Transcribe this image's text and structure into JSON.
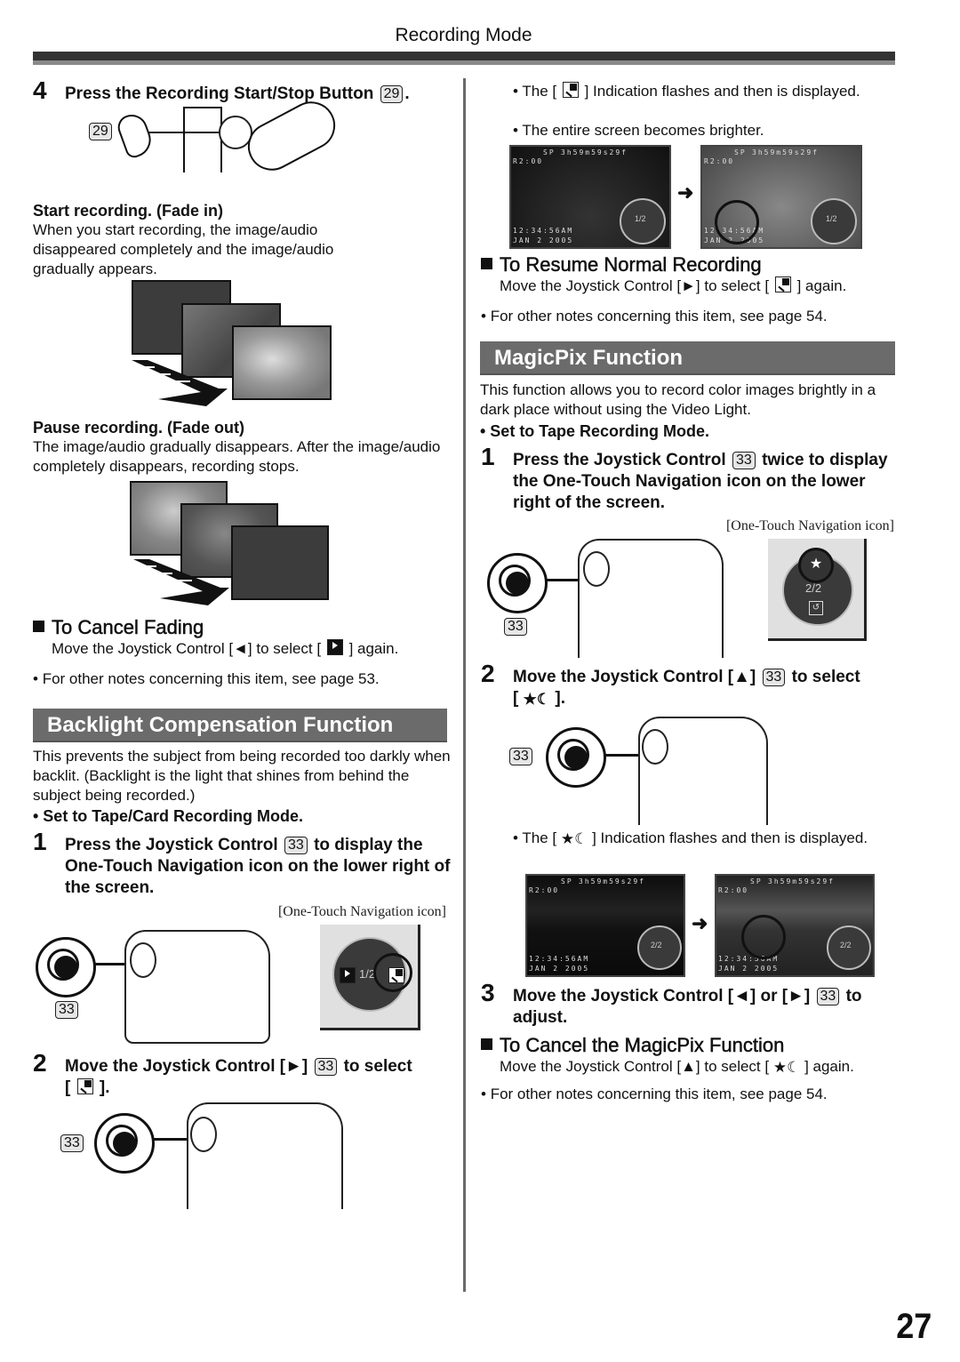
{
  "header": {
    "section_title": "Recording Mode"
  },
  "page_number": "27",
  "left": {
    "step4": {
      "number": "4",
      "text": "Press the Recording Start/Stop Button",
      "ref": "29",
      "suffix": "."
    },
    "step4_ref_label": "29",
    "fade_in": {
      "heading": "Start recording. (Fade in)",
      "body": "When you start recording, the image/audio disappeared completely and the image/audio gradually appears."
    },
    "fade_out": {
      "heading": "Pause recording. (Fade out)",
      "body": "The image/audio gradually disappears. After the image/audio completely disappears, recording stops."
    },
    "cancel_fading": {
      "heading": "To Cancel Fading",
      "body_pre": "Move the Joystick Control [◄] to select [",
      "body_post": "] again.",
      "icon": "fade-icon"
    },
    "note1": "For other notes concerning this item, see page 53.",
    "backlight": {
      "title": "Backlight Compensation Function",
      "intro": "This prevents the subject from being recorded too darkly when backlit. (Backlight is the light that shines from behind the subject being recorded.)",
      "mode": "• Set to Tape/Card Recording Mode.",
      "step1": {
        "number": "1",
        "text_pre": "Press the Joystick Control",
        "ref": "33",
        "text_post": "to display the One-Touch Navigation icon on the lower right of the screen."
      },
      "caption": "[One-Touch Navigation icon]",
      "joy_ref": "33",
      "otn_page": "1/2",
      "step2": {
        "number": "2",
        "text_pre": "Move the Joystick Control [►]",
        "ref": "33",
        "text_post": "to select",
        "line2_pre": "[",
        "line2_post": "].",
        "icon": "backlight-icon"
      },
      "joy_ref2": "33"
    }
  },
  "right": {
    "backlight_notes": [
      {
        "pre": "The [",
        "post": "] Indication flashes and then is displayed.",
        "icon": "backlight-icon"
      },
      {
        "text": "The entire screen becomes brighter."
      }
    ],
    "screen1": {
      "mode": "SP",
      "counter": "3h59m59s29f",
      "remain": "R2:00",
      "time": "12:34:56AM",
      "date": "JAN  2 2005",
      "nav_page": "1/2"
    },
    "resume": {
      "heading": "To Resume Normal Recording",
      "body_pre": "Move the Joystick Control [►] to select [",
      "body_post": "] again.",
      "icon": "backlight-icon"
    },
    "note_resume": "For other notes concerning this item, see page 54.",
    "magicpix": {
      "title": "MagicPix Function",
      "intro": "This function allows you to record color images brightly in a dark place without using the Video Light.",
      "mode": "• Set to Tape Recording Mode.",
      "step1": {
        "number": "1",
        "text_pre": "Press the Joystick Control",
        "ref": "33",
        "text_post": "twice to display the One-Touch Navigation icon on the lower right of the screen."
      },
      "caption": "[One-Touch Navigation icon]",
      "joy_ref": "33",
      "otn_page": "2/2",
      "step2": {
        "number": "2",
        "text_pre": "Move the Joystick Control [▲]",
        "ref": "33",
        "text_post": "to select",
        "line2_pre": "[",
        "line2_post": "].",
        "icon": "magicpix-icon"
      },
      "joy_ref2": "33",
      "note_pre": "The [",
      "note_post": "] Indication flashes and then is displayed.",
      "screen2": {
        "mode": "SP",
        "counter": "3h59m59s29f",
        "remain": "R2:00",
        "time": "12:34:56AM",
        "date": "JAN  2 2005",
        "nav_page": "2/2"
      },
      "step3": {
        "number": "3",
        "text_pre": "Move the Joystick Control [◄] or [►]",
        "ref": "33",
        "text_post": "to adjust."
      },
      "cancel": {
        "heading": "To Cancel the MagicPix Function",
        "body_pre": "Move the Joystick Control [▲] to select [",
        "body_post": "] again.",
        "icon": "magicpix-icon"
      },
      "note": "For other notes concerning this item, see page 54."
    }
  }
}
